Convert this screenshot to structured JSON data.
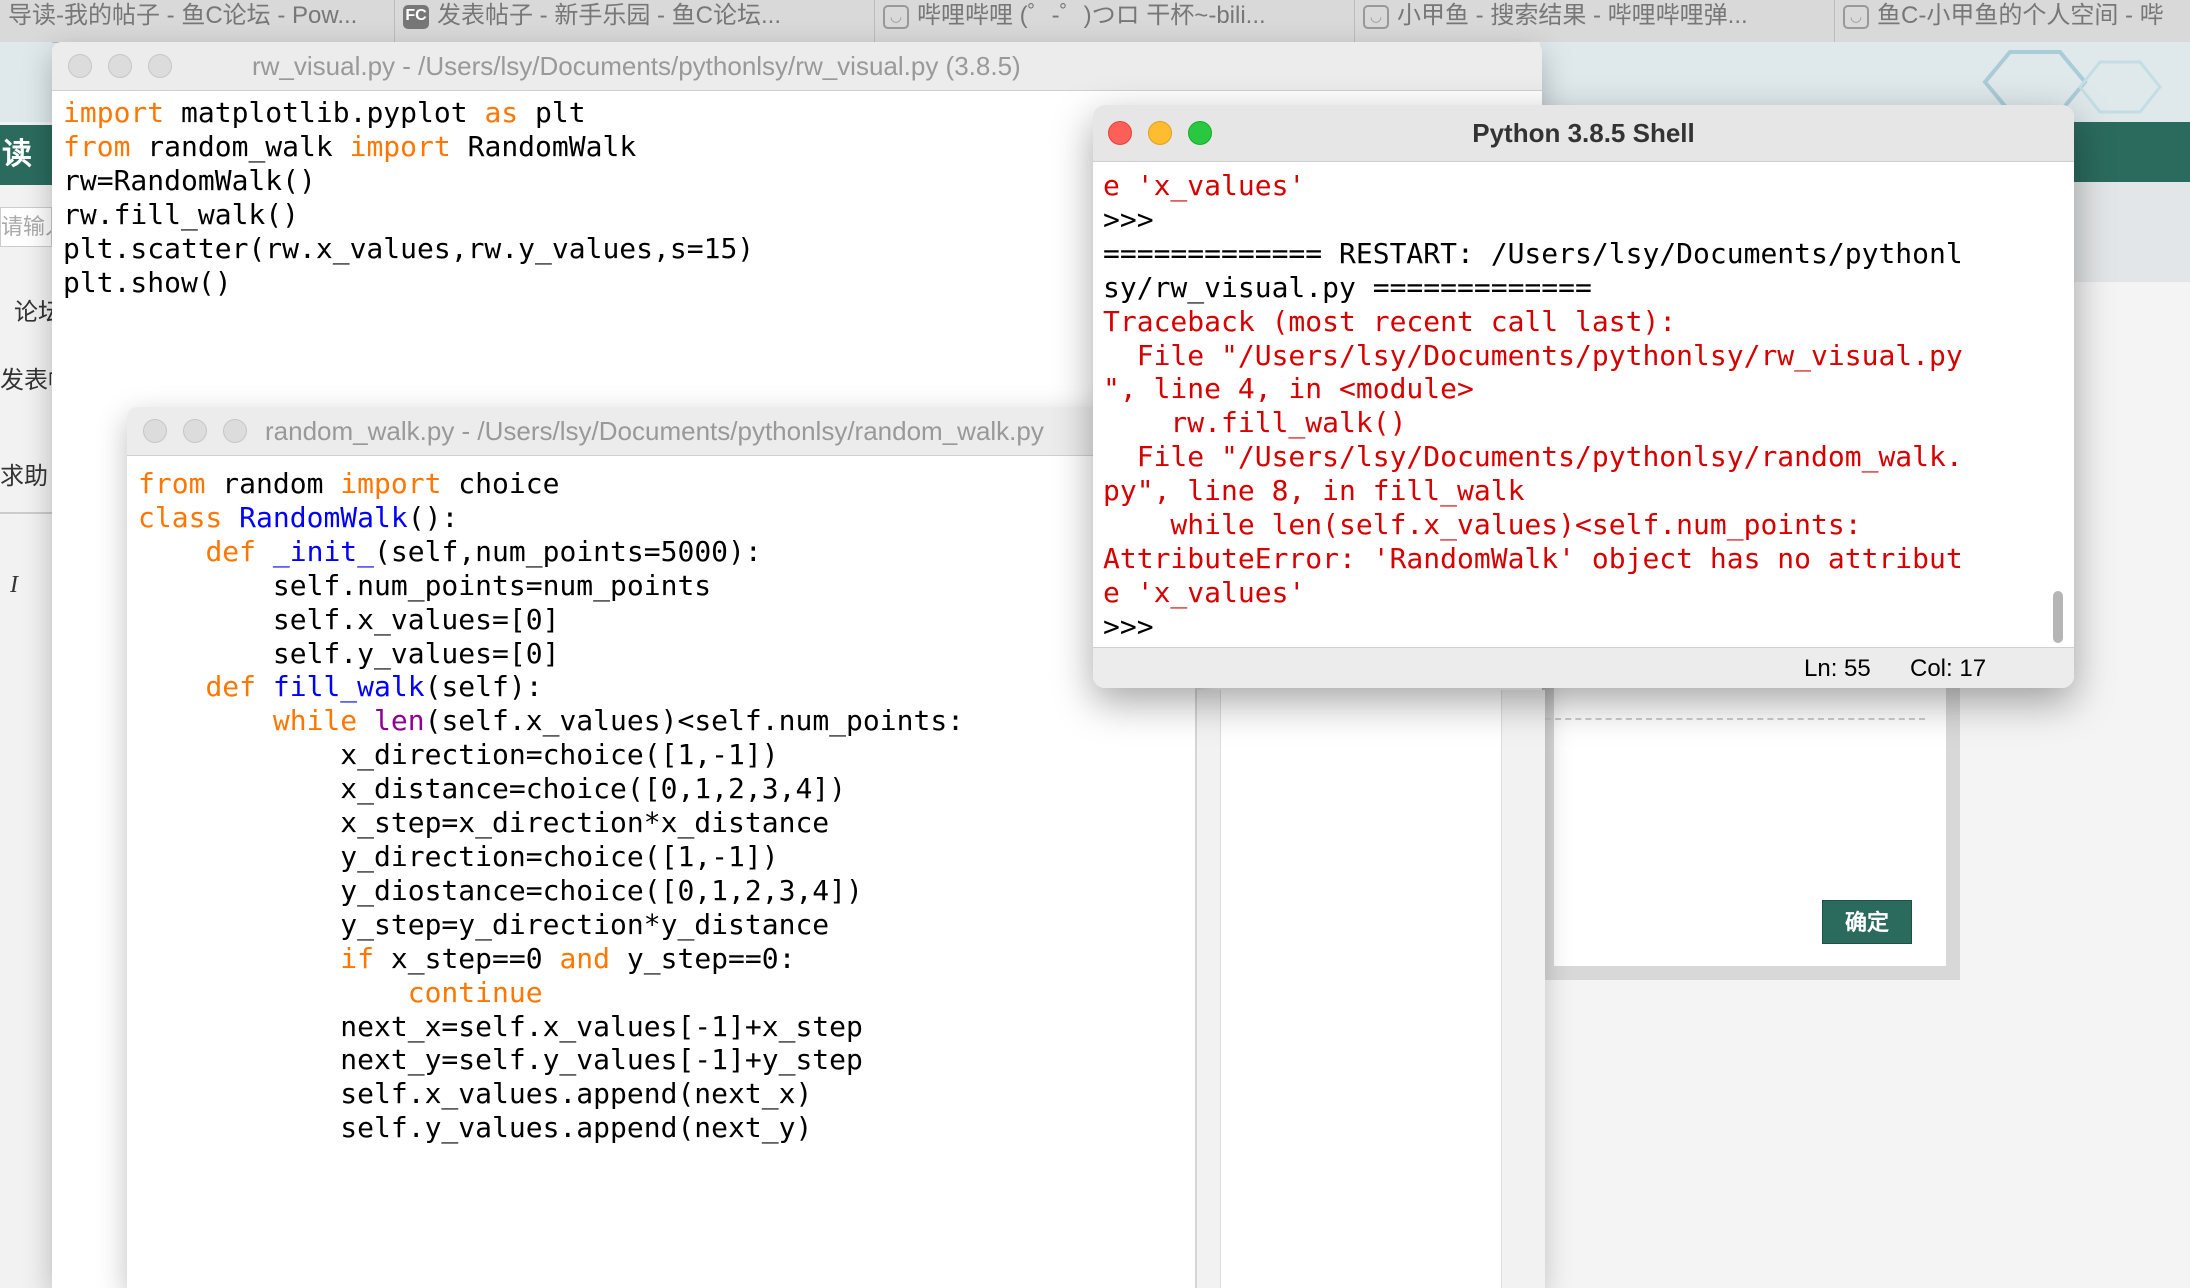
{
  "browser_tabs": [
    {
      "title": "导读-我的帖子 - 鱼C论坛 - Pow...",
      "icon": "none"
    },
    {
      "title": "发表帖子 - 新手乐园 - 鱼C论坛...",
      "icon": "FC"
    },
    {
      "title": "哔哩哔哩 (゜-゜)つロ 干杯~-bili...",
      "icon": "bilibili-icon"
    },
    {
      "title": "小甲鱼 - 搜索结果 - 哔哩哔哩弹...",
      "icon": "bilibili-icon"
    },
    {
      "title": "鱼C-小甲鱼的个人空间 - 哔",
      "icon": "bilibili-icon"
    }
  ],
  "forum_page": {
    "read_label": "读",
    "search_placeholder": "请输入",
    "nav": [
      "论坛",
      "发表帖子",
      "求助"
    ],
    "italic_label": "I",
    "confirm_button": "确定"
  },
  "rw_visual_window": {
    "title": "rw_visual.py - /Users/lsy/Documents/pythonlsy/rw_visual.py (3.8.5)"
  },
  "random_walk_window": {
    "title": "random_walk.py - /Users/lsy/Documents/pythonlsy/random_walk.py"
  },
  "shell_window": {
    "title": "Python 3.8.5 Shell",
    "status": {
      "line": "Ln: 55",
      "col": "Col: 17"
    }
  }
}
